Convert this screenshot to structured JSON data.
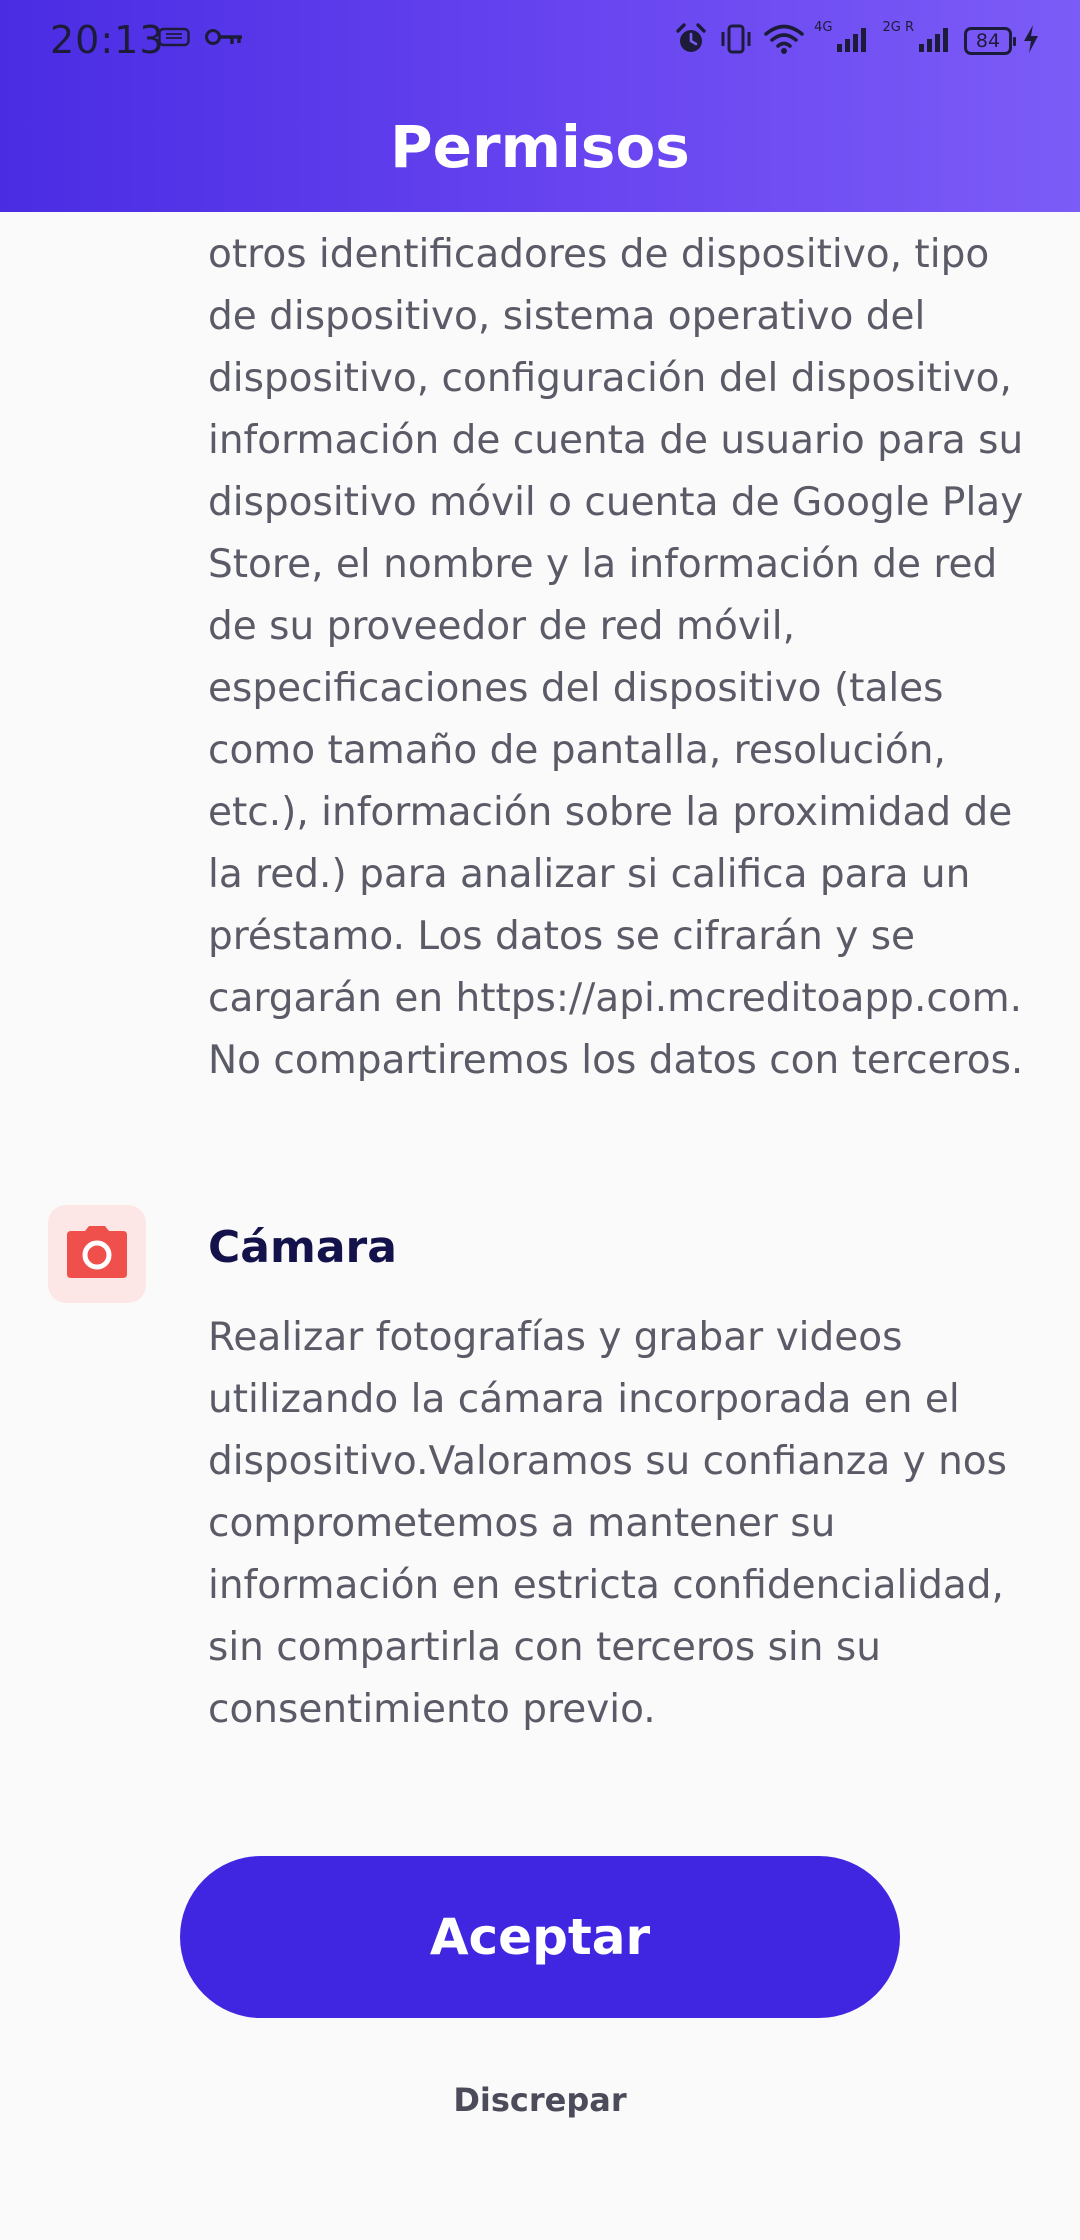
{
  "status_bar": {
    "time": "20:13",
    "battery_level": "84",
    "signal_1_label": "4G",
    "signal_2_label": "2G R"
  },
  "header": {
    "title": "Permisos"
  },
  "sections": {
    "device_info_text": "otros identificadores de dispositivo, tipo de dispositivo, sistema operativo del dispositivo, configuración del dispositivo, información de cuenta de usuario para su dispositivo móvil o cuenta de Google Play Store, el nombre y la información de red de su proveedor de red móvil, especificaciones del dispositivo (tales como tamaño de pantalla, resolución, etc.), información sobre la proximidad de la red.) para analizar si califica para un préstamo. Los datos se cifrarán y se cargarán en https://api.mcreditoapp.com. No compartiremos los datos con terceros.",
    "camera": {
      "title": "Cámara",
      "description": "Realizar fotografías y grabar videos utilizando la cámara incorporada en el dispositivo.Valoramos su confianza y nos comprometemos a mantener su información en estricta confidencialidad, sin compartirla con terceros sin su consentimiento previo.",
      "icon": "camera-icon"
    }
  },
  "actions": {
    "accept_label": "Aceptar",
    "decline_label": "Discrepar"
  },
  "colors": {
    "header_gradient_start": "#4a2ce3",
    "header_gradient_end": "#7c5cf7",
    "primary_button": "#4026e0",
    "camera_icon": "#f0504b",
    "camera_icon_bg": "#fde7e6",
    "title_text": "#14124a",
    "body_text": "#5b5b68"
  }
}
